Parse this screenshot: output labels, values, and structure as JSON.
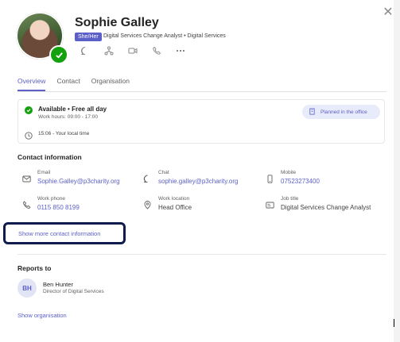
{
  "profile": {
    "name": "Sophie Galley",
    "pronouns": "She/Her",
    "subtitle": "Digital Services Change Analyst • Digital Services"
  },
  "tabs": [
    {
      "label": "Overview",
      "active": true
    },
    {
      "label": "Contact",
      "active": false
    },
    {
      "label": "Organisation",
      "active": false
    }
  ],
  "status": {
    "availability": "Available • Free all day",
    "work_hours": "Work hours: 09:00 - 17:00",
    "local_time": "15:06 - Your local time",
    "planned": "Planned in the office"
  },
  "contact": {
    "section_title": "Contact information",
    "email_label": "Email",
    "email_value": "Sophie.Galley@p3charity.org",
    "chat_label": "Chat",
    "chat_value": "sophie.galley@p3charity.org",
    "mobile_label": "Mobile",
    "mobile_value": "07523273400",
    "work_phone_label": "Work phone",
    "work_phone_value": "0115 850 8199",
    "work_location_label": "Work location",
    "work_location_value": "Head Office",
    "job_title_label": "Job title",
    "job_title_value": "Digital Services Change Analyst",
    "show_more": "Show more contact information"
  },
  "reports_to": {
    "section_title": "Reports to",
    "initials": "BH",
    "name": "Ben Hunter",
    "title": "Director of Digital Services",
    "show_org": "Show organisation"
  },
  "icons": {
    "close": "close-icon",
    "presence": "check-icon",
    "actions": [
      "chat-icon",
      "org-chart-icon",
      "video-icon",
      "phone-icon",
      "more-icon"
    ]
  },
  "colors": {
    "accent": "#5b5fc7",
    "available": "#13a10e",
    "highlight_border": "#0f1b4c"
  }
}
